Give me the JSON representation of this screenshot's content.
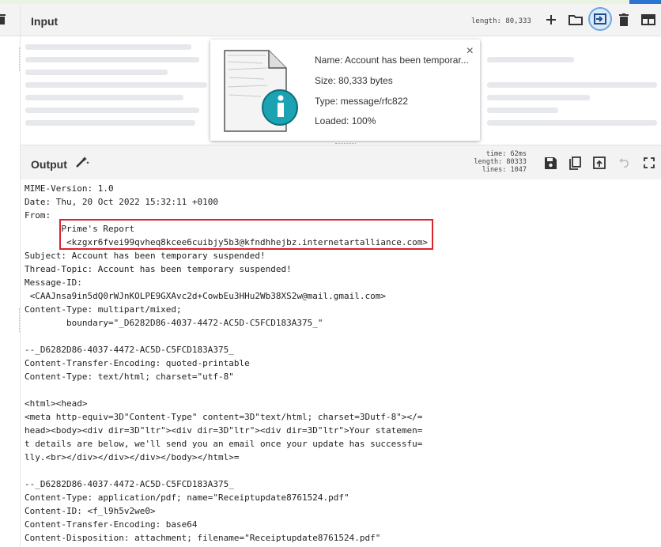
{
  "input": {
    "title": "Input",
    "length_label": "length: 80,333"
  },
  "popup": {
    "name": "Name: Account has been temporar...",
    "size": "Size: 80,333 bytes",
    "type": "Type: message/rfc822",
    "loaded": "Loaded: 100%",
    "close": "×"
  },
  "output": {
    "title": "Output",
    "stats": {
      "time": "time:  62ms",
      "length": "length: 80333",
      "lines": "lines:  1047"
    },
    "lines": [
      "MIME-Version: 1.0",
      "Date: Thu, 20 Oct 2022 15:32:11 +0100",
      "From:",
      "       Prime's Report",
      "        <kzgxr6fvei99qvheq8kcee6cuibjy5b3@kfndhhejbz.internetartalliance.com>",
      "Subject: Account has been temporary suspended!",
      "Thread-Topic: Account has been temporary suspended!",
      "Message-ID:",
      " <CAAJnsa9in5dQ0rWJnKOLPE9GXAvc2d+CowbEu3HHu2Wb38XS2w@mail.gmail.com>",
      "Content-Type: multipart/mixed;",
      "        boundary=\"_D6282D86-4037-4472-AC5D-C5FCD183A375_\"",
      "",
      "--_D6282D86-4037-4472-AC5D-C5FCD183A375_",
      "Content-Transfer-Encoding: quoted-printable",
      "Content-Type: text/html; charset=\"utf-8\"",
      "",
      "<html><head>",
      "<meta http-equiv=3D\"Content-Type\" content=3D\"text/html; charset=3Dutf-8\"></=",
      "head><body><div dir=3D\"ltr\"><div dir=3D\"ltr\"><div dir=3D\"ltr\">Your statemen=",
      "t details are below, we'll send you an email once your update has successfu=",
      "lly.<br></div></div></div></body></html>=",
      "",
      "--_D6282D86-4037-4472-AC5D-C5FCD183A375_",
      "Content-Type: application/pdf; name=\"Receiptupdate8761524.pdf\"",
      "Content-ID: <f_l9h5v2we0>",
      "Content-Transfer-Encoding: base64",
      "Content-Disposition: attachment; filename=\"Receiptupdate8761524.pdf\""
    ]
  },
  "colors": {
    "highlight_box": "#d9232d",
    "active_icon_ring": "#2b75d0"
  }
}
